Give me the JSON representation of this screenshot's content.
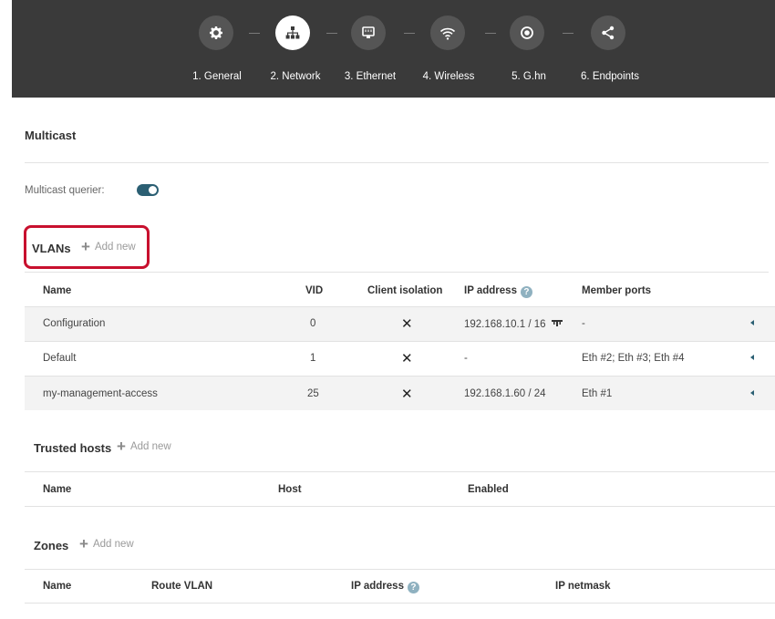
{
  "wizard": {
    "steps": [
      {
        "label": "1. General",
        "icon": "gear-icon"
      },
      {
        "label": "2. Network",
        "icon": "network-icon"
      },
      {
        "label": "3. Ethernet",
        "icon": "ethernet-port-icon"
      },
      {
        "label": "4. Wireless",
        "icon": "wifi-icon"
      },
      {
        "label": "5. G.hn",
        "icon": "record-icon"
      },
      {
        "label": "6. Endpoints",
        "icon": "share-icon"
      }
    ],
    "active_step": 2
  },
  "multicast": {
    "title": "Multicast",
    "querier_label": "Multicast querier:",
    "querier_enabled": true
  },
  "vlans": {
    "title": "VLANs",
    "add_new": "Add new",
    "columns": [
      "Name",
      "VID",
      "Client isolation",
      "IP address",
      "Member ports"
    ],
    "rows": [
      {
        "name": "Configuration",
        "vid": "0",
        "client_isolation": "✕",
        "ip": "192.168.10.1 / 16",
        "members": "-"
      },
      {
        "name": "Default",
        "vid": "1",
        "client_isolation": "✕",
        "ip": "-",
        "members": "Eth #2; Eth #3; Eth #4"
      },
      {
        "name": "my-management-access",
        "vid": "25",
        "client_isolation": "✕",
        "ip": "192.168.1.60 / 24",
        "members": "Eth #1"
      }
    ]
  },
  "trusted_hosts": {
    "title": "Trusted hosts",
    "add_new": "Add new",
    "columns": [
      "Name",
      "Host",
      "Enabled"
    ]
  },
  "zones": {
    "title": "Zones",
    "add_new": "Add new",
    "columns": [
      "Name",
      "Route VLAN",
      "IP address",
      "IP netmask"
    ]
  },
  "colors": {
    "header_bg": "#3a3a3a",
    "accent": "#2b5f73",
    "highlight": "#c8102e"
  }
}
